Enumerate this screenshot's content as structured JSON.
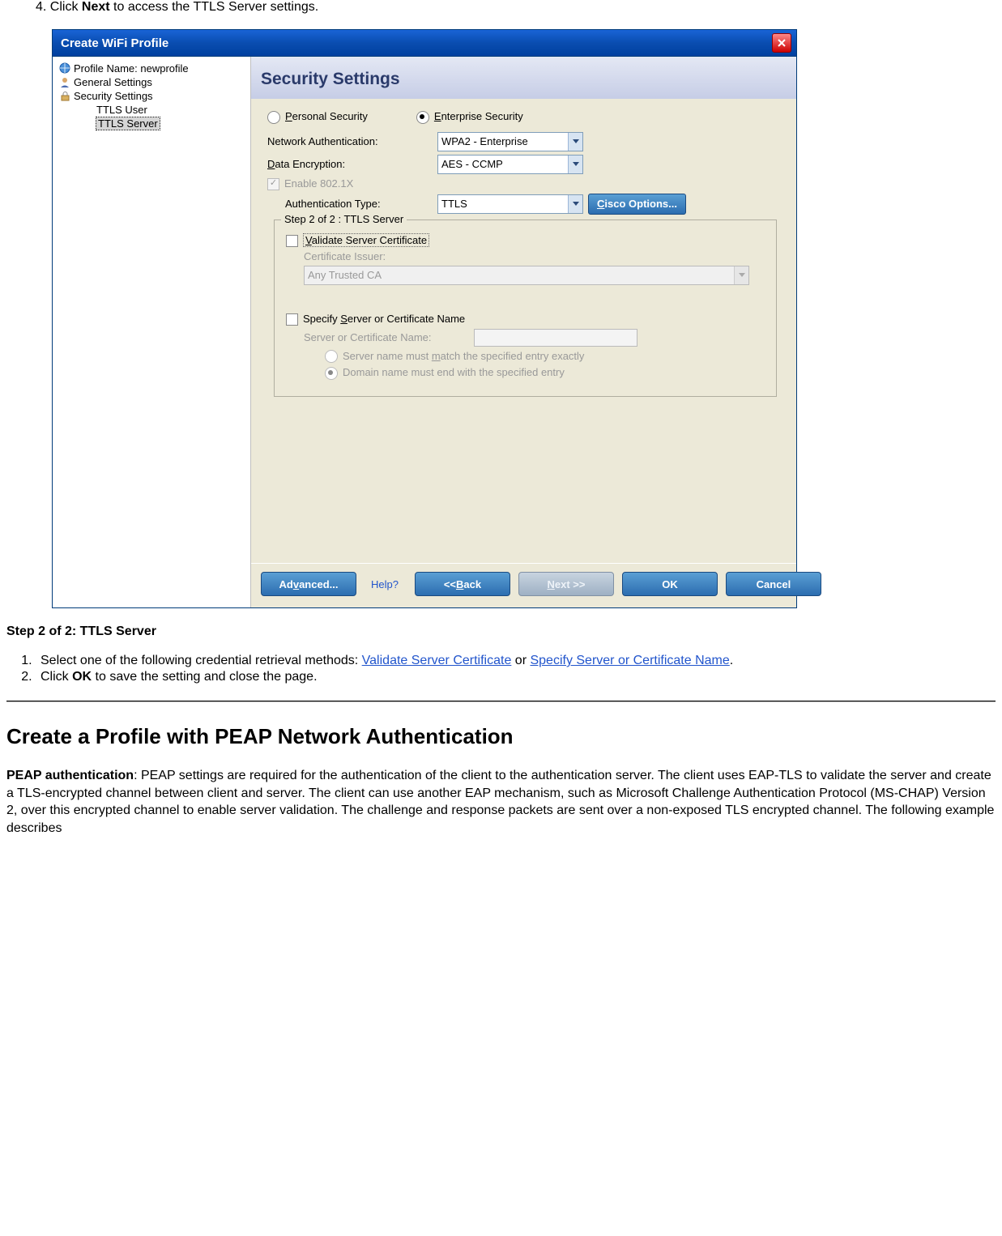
{
  "instr_prefix": "4.  Click ",
  "instr_bold": "Next",
  "instr_suffix": " to access the TTLS Server settings.",
  "titlebar": "Create WiFi Profile",
  "tree": {
    "profile": "Profile Name: newprofile",
    "general": "General Settings",
    "security": "Security Settings",
    "ttls_user": "TTLS User",
    "ttls_server": "TTLS Server"
  },
  "section_header": "Security Settings",
  "radios": {
    "personal": "Personal Security",
    "enterprise": "Enterprise Security"
  },
  "fields": {
    "network_auth": "Network Authentication:",
    "network_auth_val": "WPA2 - Enterprise",
    "data_enc": "Data Encryption:",
    "data_enc_val": "AES - CCMP",
    "enable_8021x": "Enable 802.1X",
    "auth_type": "Authentication Type:",
    "auth_type_val": "TTLS",
    "cisco": "Cisco Options..."
  },
  "group": {
    "legend": "Step 2 of 2 : TTLS Server",
    "validate": "Validate Server Certificate",
    "cert_issuer": "Certificate Issuer:",
    "cert_issuer_val": "Any Trusted CA",
    "specify": "Specify Server or Certificate Name",
    "servname_lbl": "Server or Certificate Name:",
    "match_exact": "Server name must match the specified entry exactly",
    "match_domain": "Domain name must end with the specified entry"
  },
  "buttons": {
    "advanced": "Advanced...",
    "help": "Help?",
    "back": "<< Back",
    "next": "Next >>",
    "ok": "OK",
    "cancel": "Cancel"
  },
  "step_title": "Step 2 of 2: TTLS Server",
  "steps": {
    "one_a": "Select one of the following credential retrieval methods: ",
    "link1": "Validate Server Certificate",
    "one_b": " or ",
    "link2": "Specify Server or Certificate Name",
    "one_c": ".",
    "two_a": "Click ",
    "two_bold": "OK",
    "two_b": " to save the setting and close the page."
  },
  "peap_heading": "Create a Profile with PEAP Network Authentication",
  "peap_bold": "PEAP authentication",
  "peap_text": ": PEAP settings are required for the authentication of the client to the authentication server. The client uses EAP-TLS to validate the server and create a TLS-encrypted channel between client and server. The client can use another EAP mechanism, such as Microsoft Challenge Authentication Protocol (MS-CHAP) Version 2, over this encrypted channel to enable server validation. The challenge and response packets are sent over a non-exposed TLS encrypted channel. The following example describes"
}
